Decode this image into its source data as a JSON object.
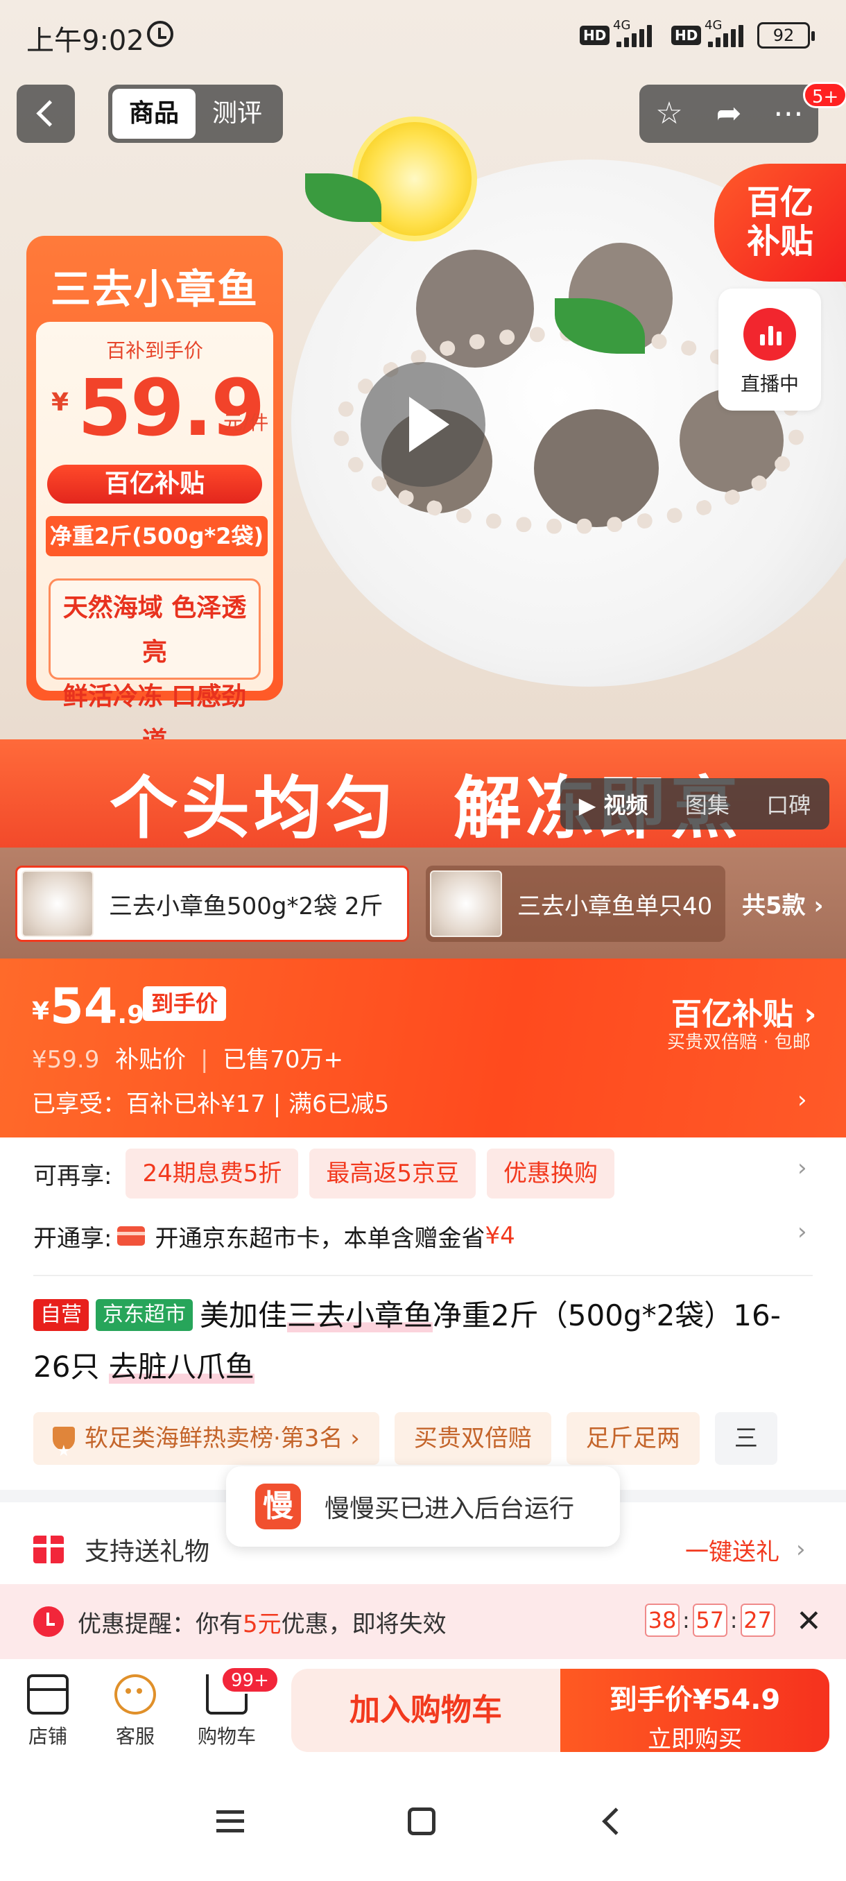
{
  "status_bar": {
    "time": "上午9:02",
    "hd1": "HD",
    "g1": "4G",
    "hd2": "HD",
    "g2": "4G",
    "battery": "92"
  },
  "top_nav": {
    "tabs": [
      {
        "label": "商品",
        "active": true
      },
      {
        "label": "测评",
        "active": false
      }
    ],
    "message_badge": "5+",
    "icons": [
      "star-icon",
      "share-icon",
      "more-icon"
    ]
  },
  "hero": {
    "subsidy_corner": "百亿\n补贴",
    "live_label": "直播中",
    "promo_card": {
      "title": "三去小章鱼",
      "price_label": "百补到手价",
      "currency": "¥",
      "price": "59.9",
      "unit": "元/件",
      "subsidy_pill": "百亿补贴",
      "net_weight": "净重2斤(500g*2袋)",
      "features_line1": "天然海域 色泽透亮",
      "features_line2": "鲜活冷冻 口感劲道"
    },
    "slogan": "个头均匀  解冻即烹",
    "media_tabs": [
      {
        "label": "▶ 视频",
        "active": true
      },
      {
        "label": "图集",
        "active": false
      },
      {
        "label": "口碑",
        "active": false
      }
    ]
  },
  "variants": {
    "items": [
      {
        "name": "三去小章鱼500g*2袋 2斤",
        "selected": true
      },
      {
        "name": "三去小章鱼单只40",
        "selected": false
      }
    ],
    "count_label": "共5款 ›"
  },
  "price_band": {
    "currency": "¥",
    "price_int": "54",
    "price_dec": ".9",
    "tag": "到手价",
    "orig_price": "¥59.9",
    "orig_label": "补贴价",
    "sold": "已售70万+",
    "enjoyed": "已享受：百补已补¥17 | 满6已减5",
    "brand": "百亿补贴 ›",
    "brand_note": "买贵双倍赔 · 包邮"
  },
  "benefits": {
    "label": "可再享:",
    "chips": [
      "24期息费5折",
      "最高返5京豆",
      "优惠换购"
    ]
  },
  "open_card": {
    "label": "开通享:",
    "text": "开通京东超市卡，本单含赠金省",
    "amount": "¥4"
  },
  "product": {
    "tag_self": "自营",
    "tag_store": "京东超市",
    "title_pre": "美加佳",
    "title_hl": "三去小章鱼",
    "title_post": "净重2斤（500g*2袋）16-26只 ",
    "title_hl2": "去脏八爪鱼"
  },
  "tags": [
    "软足类海鲜热卖榜·第3名 ›",
    "买贵双倍赔",
    "足斤足两",
    "三"
  ],
  "toast": {
    "icon_char": "慢",
    "message": "慢慢买已进入后台运行"
  },
  "gift": {
    "text": "支持送礼物",
    "link": "一键送礼"
  },
  "reminder": {
    "prefix": "优惠提醒：你有",
    "amount": "5元",
    "suffix": "优惠，即将失效",
    "countdown": [
      "38",
      "57",
      "27"
    ]
  },
  "bottom_bar": {
    "store": "店铺",
    "service": "客服",
    "cart": "购物车",
    "cart_badge": "99+",
    "add_to_cart": "加入购物车",
    "buy_price": "到手价¥54.9",
    "buy_now": "立即购买"
  },
  "colors": {
    "accent": "#f2391e",
    "brand_orange": "#ff5a28",
    "store_green": "#27a55a"
  }
}
